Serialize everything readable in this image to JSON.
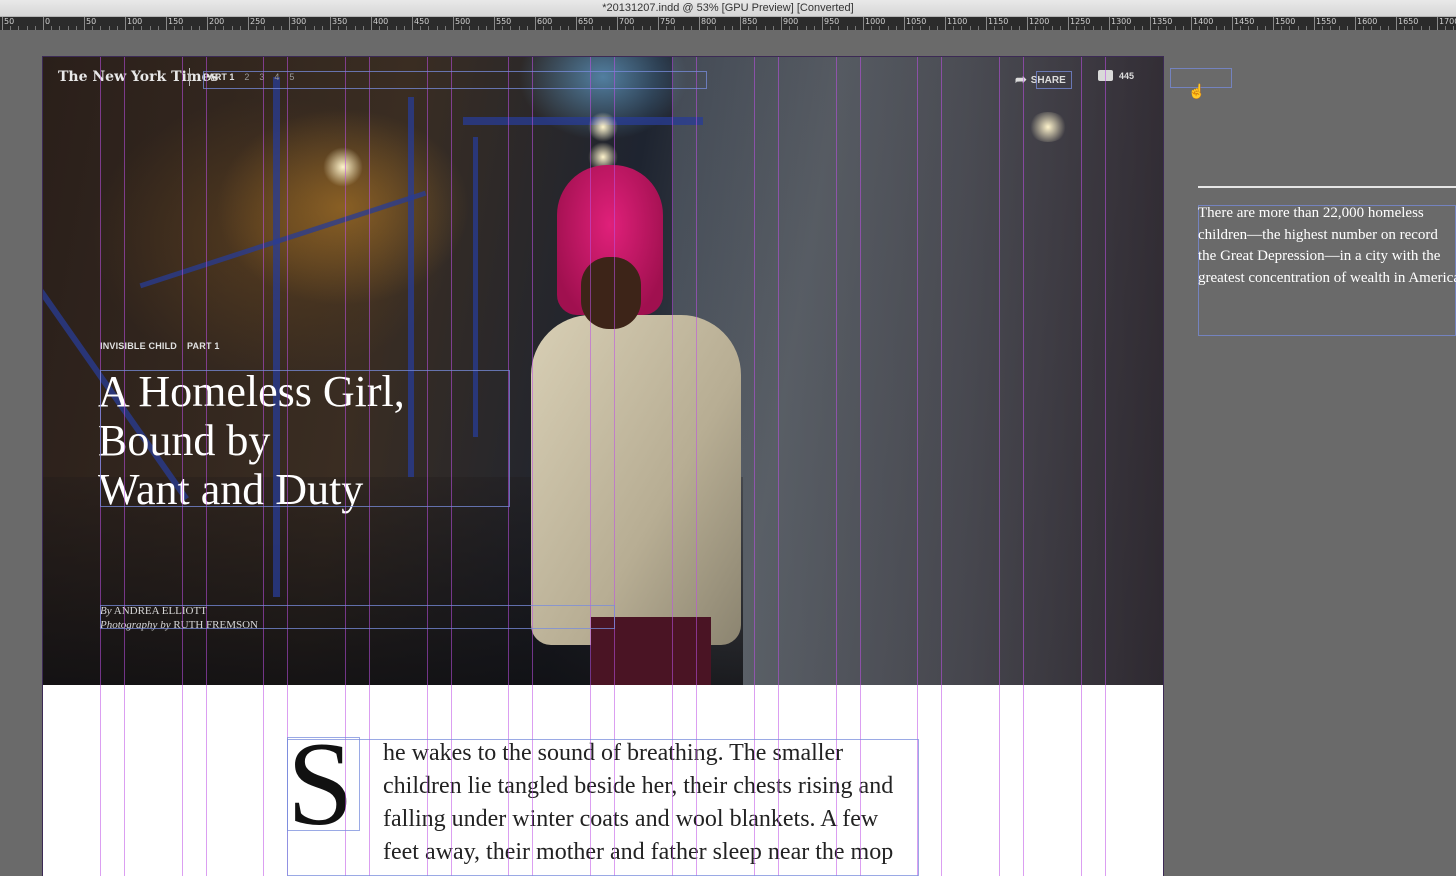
{
  "window": {
    "title": "*20131207.indd @ 53% [GPU Preview] [Converted]"
  },
  "ruler": {
    "labels": [
      "50",
      "0",
      "50",
      "100",
      "150",
      "200",
      "250",
      "300",
      "350",
      "400",
      "450",
      "500",
      "550",
      "600",
      "650",
      "700",
      "750",
      "800",
      "850",
      "900",
      "950",
      "1000",
      "1050",
      "1100",
      "1150",
      "1200",
      "1250",
      "1300",
      "1350",
      "1400",
      "1450",
      "1500",
      "1550",
      "1600",
      "1650",
      "1700"
    ]
  },
  "masthead": {
    "logo": "The New York Times",
    "parts": {
      "current": "PART 1",
      "others": [
        "2",
        "3",
        "4",
        "5"
      ]
    },
    "share_label": "SHARE",
    "comment_count": "445"
  },
  "article": {
    "kicker": {
      "series": "INVISIBLE CHILD",
      "part": "PART 1"
    },
    "headline": [
      "A Homeless Girl,",
      "Bound by",
      "Want and Duty"
    ],
    "byline": {
      "by": "By",
      "author": "ANDREA ELLIOTT",
      "photo_prefix": "Photography by",
      "photographer": "RUTH FREMSON"
    },
    "dropcap": "S",
    "body_lines": [
      "he wakes to the sound of breathing. The smaller",
      "children lie tangled beside her, their chests rising and",
      "falling under winter coats and wool blankets. A few",
      "feet away, their mother and father sleep near the mop"
    ]
  },
  "pasteboard": {
    "text_lines": [
      "There are more than 22,000 homeless",
      "children—the highest number on record",
      "the Great Depression—in a city with the",
      "greatest concentration of wealth in America"
    ]
  },
  "icons": {
    "share": "share-arrow-icon",
    "comments": "comment-bubble-icon",
    "cursor": "hand-cursor-icon"
  },
  "colors": {
    "guide": "#be50e6",
    "frame": "#788cdc",
    "pasteboard": "#6a6a6a"
  }
}
